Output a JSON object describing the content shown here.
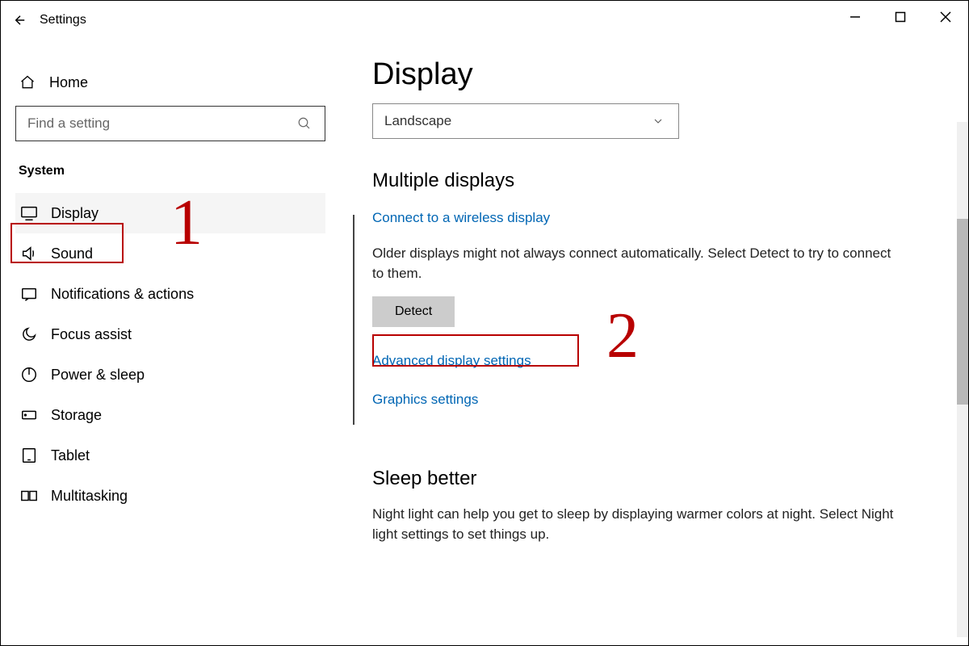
{
  "titlebar": {
    "title": "Settings"
  },
  "sidebar": {
    "home": "Home",
    "search_placeholder": "Find a setting",
    "section": "System",
    "items": [
      {
        "label": "Display"
      },
      {
        "label": "Sound"
      },
      {
        "label": "Notifications & actions"
      },
      {
        "label": "Focus assist"
      },
      {
        "label": "Power & sleep"
      },
      {
        "label": "Storage"
      },
      {
        "label": "Tablet"
      },
      {
        "label": "Multitasking"
      }
    ]
  },
  "content": {
    "page_title": "Display",
    "orientation_value": "Landscape",
    "multiple_displays": {
      "heading": "Multiple displays",
      "wireless_link": "Connect to a wireless display",
      "detect_text": "Older displays might not always connect automatically. Select Detect to try to connect to them.",
      "detect_button": "Detect",
      "advanced_link": "Advanced display settings",
      "graphics_link": "Graphics settings"
    },
    "sleep_better": {
      "heading": "Sleep better",
      "text": "Night light can help you get to sleep by displaying warmer colors at night. Select Night light settings to set things up."
    }
  },
  "annotations": {
    "one": "1",
    "two": "2"
  }
}
